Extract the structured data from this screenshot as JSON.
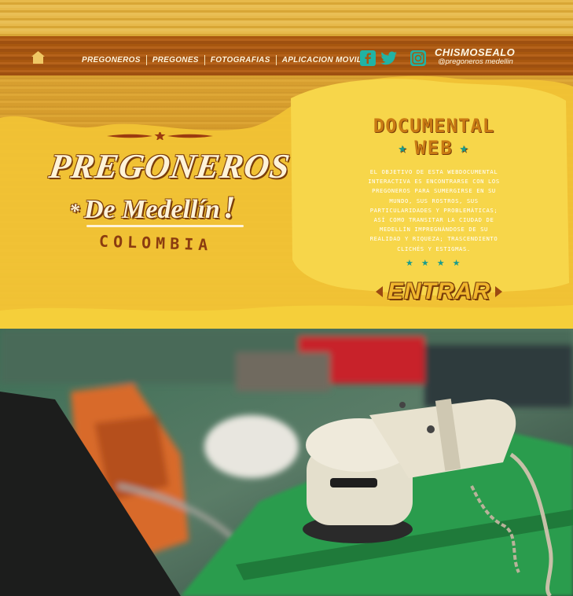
{
  "nav": {
    "home_icon": "home-icon",
    "items": [
      "PREGONEROS",
      "PREGONES",
      "FOTOGRAFIAS",
      "APLICACION MOVIL"
    ]
  },
  "social": {
    "icons": [
      "facebook-icon",
      "twitter-icon",
      "instagram-icon"
    ],
    "title": "CHISMOSEALO",
    "handle": "@pregoneros medellin"
  },
  "hero": {
    "title_line1": "PREGONEROS",
    "title_line2": "De Medellín",
    "asterisk": "*",
    "exclamation": "!",
    "country": "COLOMBIA"
  },
  "documental": {
    "line1": "DOCUMENTAL",
    "line2": "WEB",
    "description": "EL OBJETIVO DE ESTA WEBDOCUMENTAL INTERACTIVA ES ENCONTRARSE CON LOS PREGONEROS PARA SUMERGIRSE EN SU MUNDO, SUS ROSTROS, SUS PARTICULARIDADES Y PROBLEMÁTICAS; ASÍ COMO TRANSITAR LA CIUDAD DE MEDELLÍN IMPREGNÁNDOSE DE SU REALIDAD Y RIQUEZA; TRASCENDIENTO CLICHÉS Y ESTIGMAS.",
    "button": "ENTRAR"
  },
  "colors": {
    "navbar": "#a8570f",
    "accent_teal": "#1a9c8c",
    "paint_yellow": "#f5cf3a",
    "text_brown": "#7a3d0a"
  }
}
